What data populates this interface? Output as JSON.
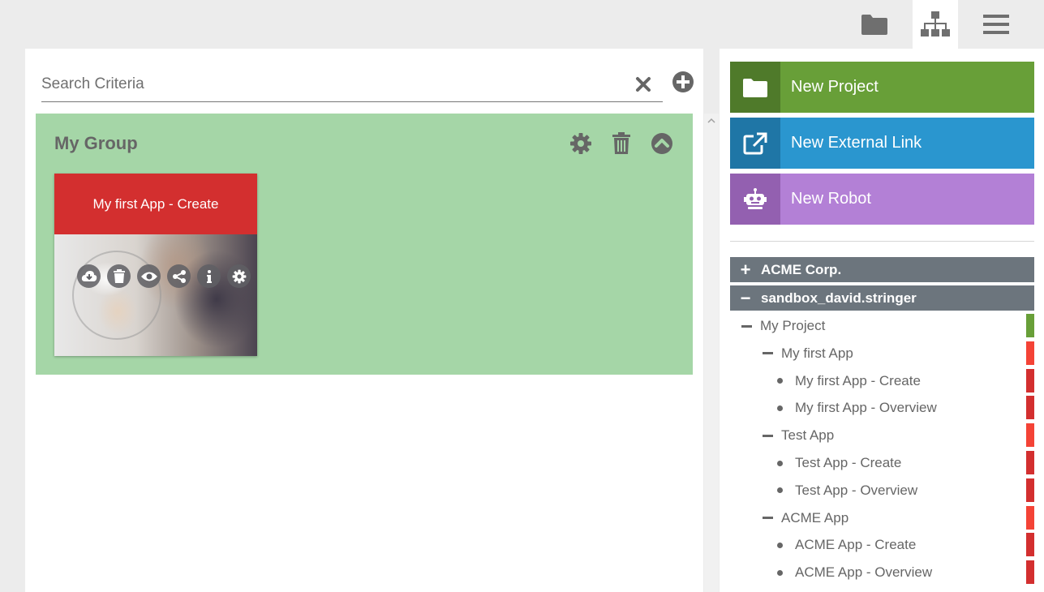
{
  "topbar": {
    "icons": [
      "folder-icon",
      "sitemap-icon",
      "menu-icon"
    ]
  },
  "search": {
    "placeholder": "Search Criteria",
    "value": ""
  },
  "group": {
    "title": "My Group",
    "bg_color": "#a5d6a7"
  },
  "card": {
    "title": "My first App - Create",
    "header_color": "#d32f2f",
    "actions": [
      "cloud-download-icon",
      "trash-icon",
      "eye-icon",
      "share-icon",
      "info-icon",
      "gear-icon"
    ]
  },
  "actions": {
    "new_project": "New Project",
    "new_external_link": "New External Link",
    "new_robot": "New Robot",
    "colors": {
      "project": "#689f38",
      "link": "#2a96cf",
      "robot": "#b380d6"
    }
  },
  "tree": {
    "orgs": [
      {
        "symbol": "+",
        "label": "ACME Corp."
      },
      {
        "symbol": "−",
        "label": "sandbox_david.stringer"
      }
    ],
    "items": [
      {
        "label": "My Project",
        "level": 1,
        "kind": "minus",
        "color": "#689f38"
      },
      {
        "label": "My first App",
        "level": 2,
        "kind": "minus",
        "color": "#f44336"
      },
      {
        "label": "My first App - Create",
        "level": 3,
        "kind": "dot",
        "color": "#d32f2f"
      },
      {
        "label": "My first App - Overview",
        "level": 3,
        "kind": "dot",
        "color": "#d32f2f"
      },
      {
        "label": "Test App",
        "level": 2,
        "kind": "minus",
        "color": "#f44336"
      },
      {
        "label": "Test App - Create",
        "level": 3,
        "kind": "dot",
        "color": "#d32f2f"
      },
      {
        "label": "Test App - Overview",
        "level": 3,
        "kind": "dot",
        "color": "#d32f2f"
      },
      {
        "label": "ACME App",
        "level": 2,
        "kind": "minus",
        "color": "#f44336"
      },
      {
        "label": "ACME App - Create",
        "level": 3,
        "kind": "dot",
        "color": "#d32f2f"
      },
      {
        "label": "ACME App - Overview",
        "level": 3,
        "kind": "dot",
        "color": "#d32f2f"
      }
    ]
  }
}
